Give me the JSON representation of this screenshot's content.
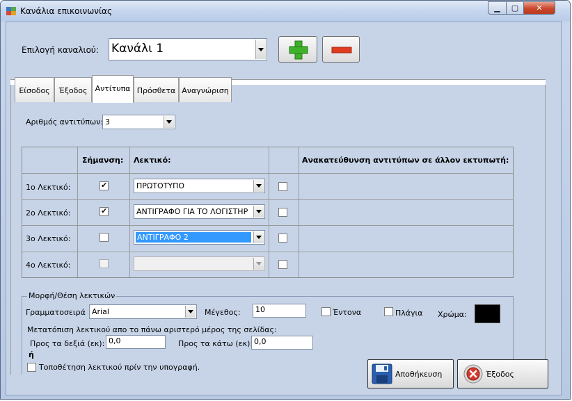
{
  "window": {
    "title": "Κανάλια επικοινωνίας"
  },
  "channel": {
    "label": "Επιλογή καναλιού:",
    "value": "Κανάλι 1"
  },
  "tabs": [
    {
      "label": "Είσοδος"
    },
    {
      "label": "Έξοδος"
    },
    {
      "label": "Αντίτυπα"
    },
    {
      "label": "Πρόσθετα"
    },
    {
      "label": "Αναγνώριση"
    }
  ],
  "copies": {
    "label": "Αριθμός αντιτύπων:",
    "value": "3"
  },
  "grid": {
    "headers": {
      "mark": "Σήμανση:",
      "caption": "Λεκτικό:",
      "redirect": "Ανακατεύθυνση αντιτύπων σε άλλον εκτυπωτή:"
    },
    "rows": [
      {
        "label": "1ο Λεκτικό:",
        "caption": "ΠΡΩΤΟΤΥΠΟ",
        "marked": true
      },
      {
        "label": "2ο Λεκτικό:",
        "caption": "ΑΝΤΙΓΡΑΦΟ ΓΙΑ ΤΟ ΛΟΓΙΣΤΗΡ",
        "marked": true
      },
      {
        "label": "3ο Λεκτικό:",
        "caption": "ΑΝΤΙΓΡΑΦΟ 2",
        "marked": false
      },
      {
        "label": "4ο Λεκτικό:",
        "caption": "",
        "marked": false
      }
    ]
  },
  "format": {
    "group_title": "Μορφή/Θέση λεκτικών",
    "font_label": "Γραμματοσειρά",
    "font_value": "Arial",
    "size_label": "Μέγεθος:",
    "size_value": "10",
    "bold_label": "Έντονα",
    "italic_label": "Πλάγια",
    "color_label": "Χρώμα:",
    "color_value": "#000000",
    "offset_label": "Μετατόπιση λεκτικού απο το πάνω αριστερό μέρος της σελίδας:",
    "right_label": "Προς τα δεξιά (εκ):",
    "right_value": "0,0",
    "down_label": "Προς τα κάτω (εκ):",
    "down_value": "0,0",
    "or_label": "ή",
    "before_sign_label": "Τοποθέτηση λεκτικού πρίν την υπογραφή."
  },
  "actions": {
    "save": "Αποθήκευση",
    "exit": "Έξοδος"
  }
}
